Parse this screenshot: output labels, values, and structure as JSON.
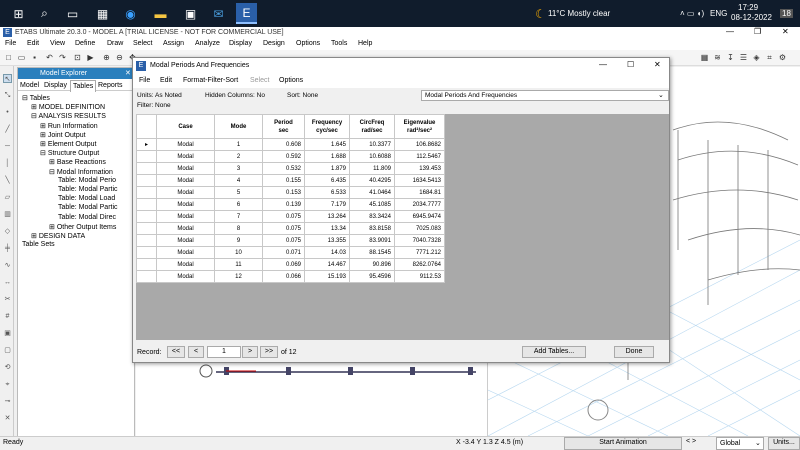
{
  "taskbar": {
    "weather": "11°C  Mostly clear",
    "lang": "ENG",
    "time": "17:29",
    "date": "08-12-2022",
    "notif": "18"
  },
  "app": {
    "title": "ETABS Ultimate 20.3.0 - MODEL A  [TRIAL LICENSE - NOT FOR COMMERCIAL USE]"
  },
  "menu": [
    "File",
    "Edit",
    "View",
    "Define",
    "Draw",
    "Select",
    "Assign",
    "Analyze",
    "Display",
    "Design",
    "Options",
    "Tools",
    "Help"
  ],
  "explorer": {
    "title": "Model Explorer",
    "tabs": [
      "Model",
      "Display",
      "Tables",
      "Reports"
    ],
    "tree": [
      {
        "label": "Tables",
        "level": 0,
        "sign": "⊟"
      },
      {
        "label": "MODEL DEFINITION",
        "level": 1,
        "sign": "⊞"
      },
      {
        "label": "ANALYSIS RESULTS",
        "level": 1,
        "sign": "⊟"
      },
      {
        "label": "Run Information",
        "level": 2,
        "sign": "⊞"
      },
      {
        "label": "Joint Output",
        "level": 2,
        "sign": "⊞"
      },
      {
        "label": "Element Output",
        "level": 2,
        "sign": "⊞"
      },
      {
        "label": "Structure Output",
        "level": 2,
        "sign": "⊟"
      },
      {
        "label": "Base Reactions",
        "level": 3,
        "sign": "⊞"
      },
      {
        "label": "Modal Information",
        "level": 3,
        "sign": "⊟"
      },
      {
        "label": "Table:  Modal Perio",
        "level": 4,
        "sign": ""
      },
      {
        "label": "Table:  Modal Partic",
        "level": 4,
        "sign": ""
      },
      {
        "label": "Table:  Modal Load",
        "level": 4,
        "sign": ""
      },
      {
        "label": "Table:  Modal Partic",
        "level": 4,
        "sign": ""
      },
      {
        "label": "Table:  Modal Direc",
        "level": 4,
        "sign": ""
      },
      {
        "label": "Other Output Items",
        "level": 3,
        "sign": "⊞"
      },
      {
        "label": "DESIGN DATA",
        "level": 1,
        "sign": "⊞"
      },
      {
        "label": "Table Sets",
        "level": 0,
        "sign": ""
      }
    ]
  },
  "dialog": {
    "title": "Modal Periods And Frequencies",
    "menu": [
      "File",
      "Edit",
      "Format-Filter-Sort",
      "Select",
      "Options"
    ],
    "units": "Units:  As Noted",
    "hidden": "Hidden Columns:  No",
    "sort": "Sort:  None",
    "filter": "Filter:  None",
    "table_select": "Modal Periods And Frequencies",
    "headers": [
      [
        "Case",
        ""
      ],
      [
        "Mode",
        ""
      ],
      [
        "Period",
        "sec"
      ],
      [
        "Frequency",
        "cyc/sec"
      ],
      [
        "CircFreq",
        "rad/sec"
      ],
      [
        "Eigenvalue",
        "rad²/sec²"
      ]
    ],
    "rows": [
      [
        "Modal",
        "1",
        "0.608",
        "1.645",
        "10.3377",
        "106.8682"
      ],
      [
        "Modal",
        "2",
        "0.592",
        "1.688",
        "10.6088",
        "112.5467"
      ],
      [
        "Modal",
        "3",
        "0.532",
        "1.879",
        "11.809",
        "139.453"
      ],
      [
        "Modal",
        "4",
        "0.155",
        "6.435",
        "40.4295",
        "1634.5413"
      ],
      [
        "Modal",
        "5",
        "0.153",
        "6.533",
        "41.0464",
        "1684.81"
      ],
      [
        "Modal",
        "6",
        "0.139",
        "7.179",
        "45.1085",
        "2034.7777"
      ],
      [
        "Modal",
        "7",
        "0.075",
        "13.264",
        "83.3424",
        "6945.9474"
      ],
      [
        "Modal",
        "8",
        "0.075",
        "13.34",
        "83.8158",
        "7025.083"
      ],
      [
        "Modal",
        "9",
        "0.075",
        "13.355",
        "83.9091",
        "7040.7328"
      ],
      [
        "Modal",
        "10",
        "0.071",
        "14.03",
        "88.1545",
        "7771.212"
      ],
      [
        "Modal",
        "11",
        "0.069",
        "14.467",
        "90.896",
        "8262.0764"
      ],
      [
        "Modal",
        "12",
        "0.066",
        "15.193",
        "95.4596",
        "9112.53"
      ]
    ],
    "record_label": "Record:",
    "record_value": "1",
    "record_of": "of 12",
    "add_tables": "Add Tables...",
    "done": "Done"
  },
  "statusbar": {
    "left": "Ready",
    "coords": "X -3.4  Y 1.3  Z 4.5 (m)",
    "animation": "Start Animation",
    "global": "Global",
    "units": "Units..."
  }
}
